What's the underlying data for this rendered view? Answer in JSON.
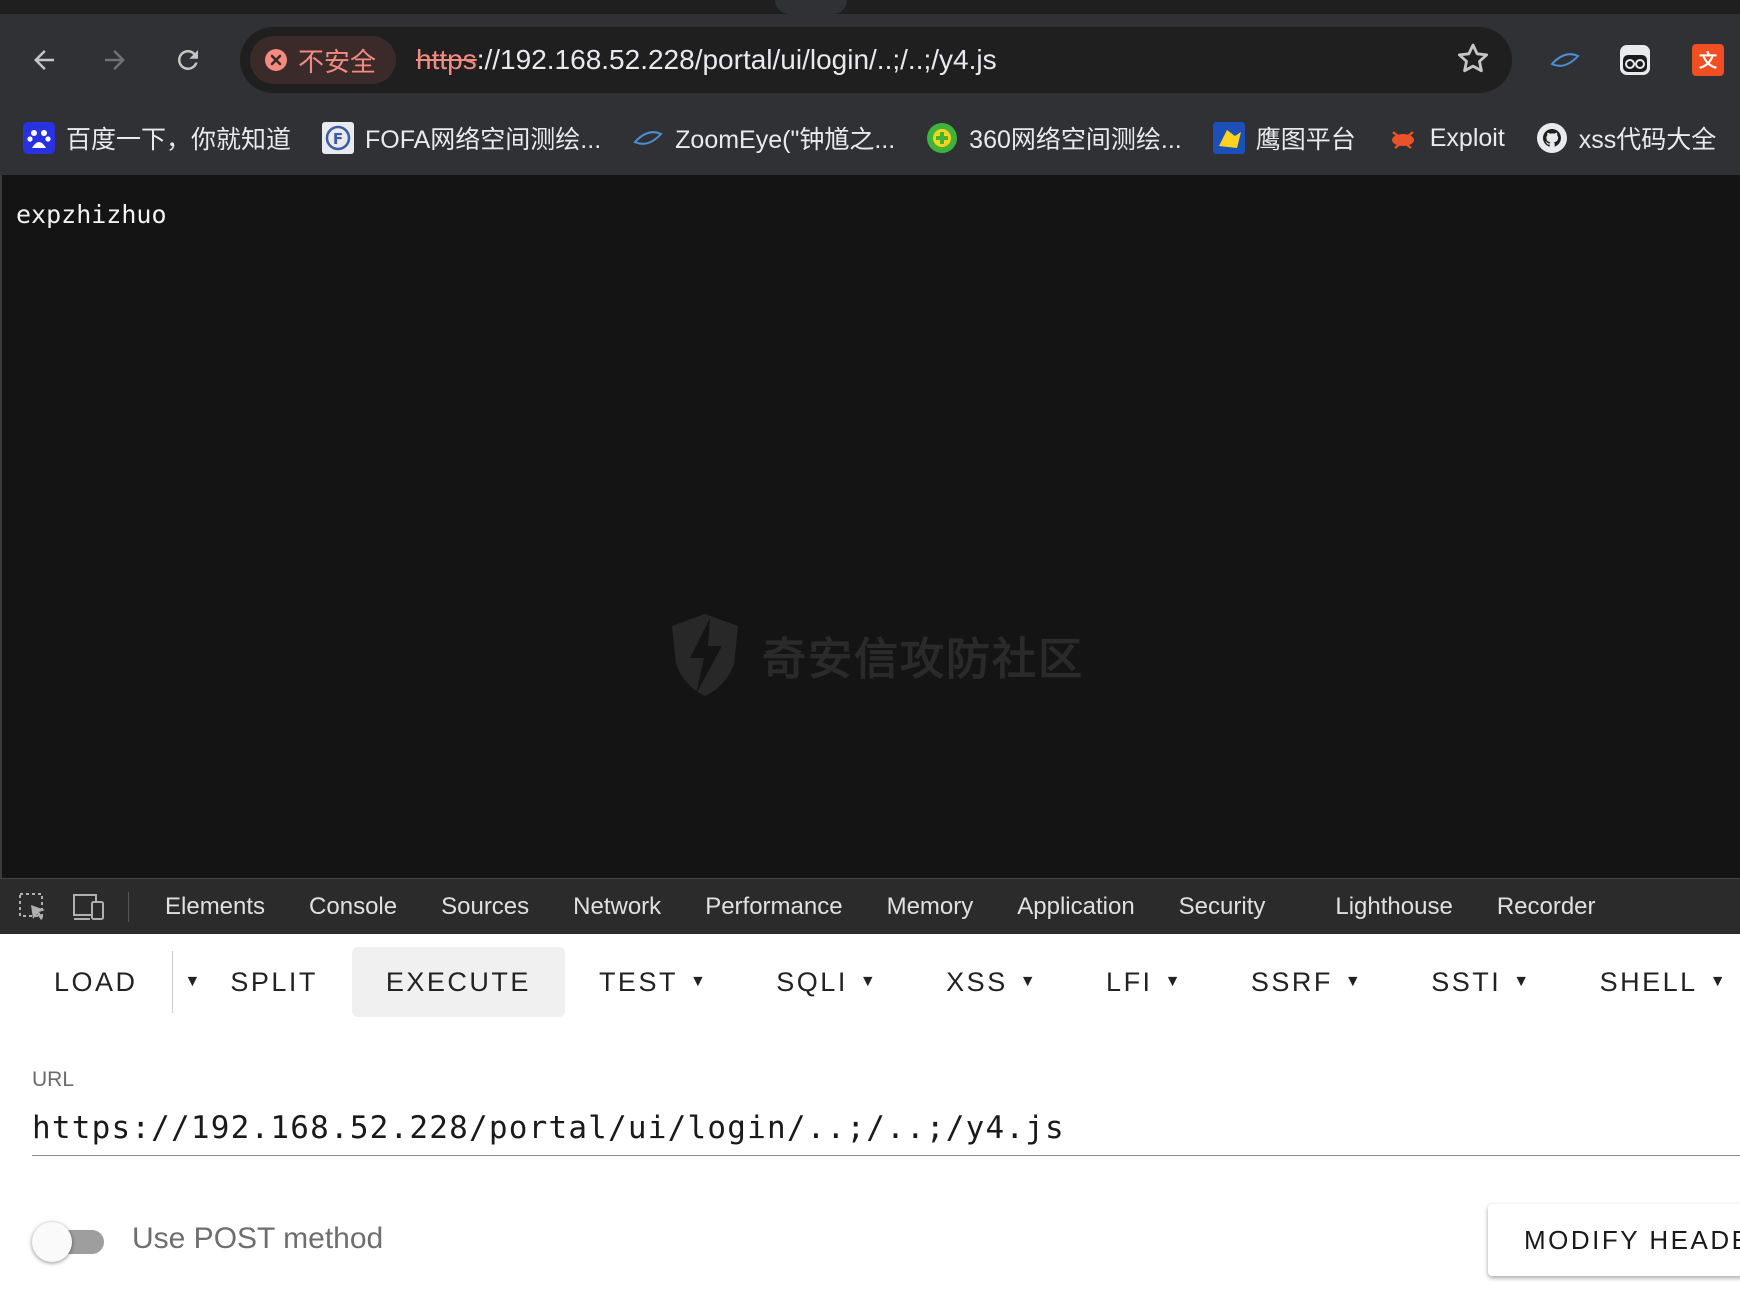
{
  "browser": {
    "security_label": "不安全",
    "url_scheme": "https",
    "url_rest": "://192.168.52.228/portal/ui/login/..;/..;/y4.js",
    "icons": {
      "back": "arrow-left-icon",
      "forward": "arrow-right-icon",
      "reload": "reload-icon",
      "bookmark": "star-icon",
      "security": "error-circle-icon"
    },
    "colors": {
      "chrome_bg": "#303134",
      "omnibox_bg": "#1f1f1f",
      "insecure_red": "#f28b82"
    }
  },
  "bookmarks": [
    {
      "label": "百度一下，你就知道",
      "icon": "baidu-icon"
    },
    {
      "label": "FOFA网络空间测绘...",
      "icon": "fofa-icon"
    },
    {
      "label": "ZoomEye(\"钟馗之...",
      "icon": "zoomeye-icon"
    },
    {
      "label": "360网络空间测绘...",
      "icon": "360-icon"
    },
    {
      "label": "鹰图平台",
      "icon": "hunter-icon"
    },
    {
      "label": "Exploit",
      "icon": "exploit-icon"
    },
    {
      "label": "xss代码大全",
      "icon": "github-icon"
    }
  ],
  "page": {
    "body_text": "expzhizhuo",
    "watermark": "奇安信攻防社区"
  },
  "devtools": {
    "tabs": [
      "Elements",
      "Console",
      "Sources",
      "Network",
      "Performance",
      "Memory",
      "Application",
      "Security",
      "Lighthouse",
      "Recorder"
    ]
  },
  "hackbar": {
    "buttons": {
      "load": "LOAD",
      "split": "SPLIT",
      "execute": "EXECUTE",
      "test": "TEST",
      "sqli": "SQLI",
      "xss": "XSS",
      "lfi": "LFI",
      "ssrf": "SSRF",
      "ssti": "SSTI",
      "shell": "SHELL"
    },
    "url_label": "URL",
    "url_value": "https://192.168.52.228/portal/ui/login/..;/..;/y4.js",
    "post_toggle_label": "Use POST method",
    "post_enabled": false,
    "modify_headers": "MODIFY HEADERS"
  }
}
